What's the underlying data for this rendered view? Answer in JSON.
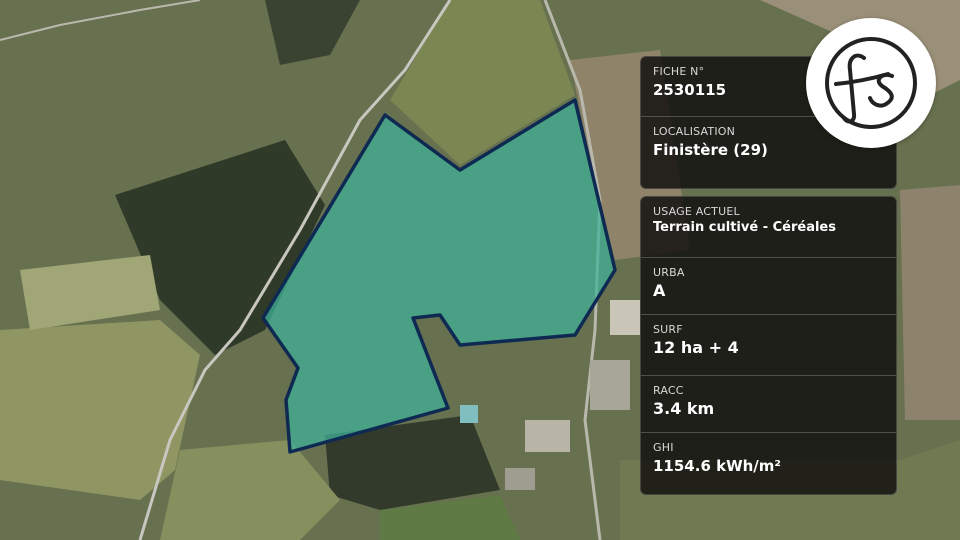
{
  "map": {
    "plot_color": "#3fb39a",
    "plot_border_color": "#0f2a52"
  },
  "fiche": {
    "label": "FICHE N°",
    "value": "2530115"
  },
  "localisation": {
    "label": "LOCALISATION",
    "value": "Finistère (29)"
  },
  "usage": {
    "label": "USAGE ACTUEL",
    "value": "Terrain cultivé - Céréales"
  },
  "urba": {
    "label": "URBA",
    "value": "A"
  },
  "surf": {
    "label": "SURF",
    "value": "12 ha + 4"
  },
  "racc": {
    "label": "RACC",
    "value": "3.4 km"
  },
  "ghi": {
    "label": "GHI",
    "value": "1154.6 kWh/m²"
  },
  "logo": {
    "text": "fs",
    "icon": "fs-monogram-logo"
  }
}
